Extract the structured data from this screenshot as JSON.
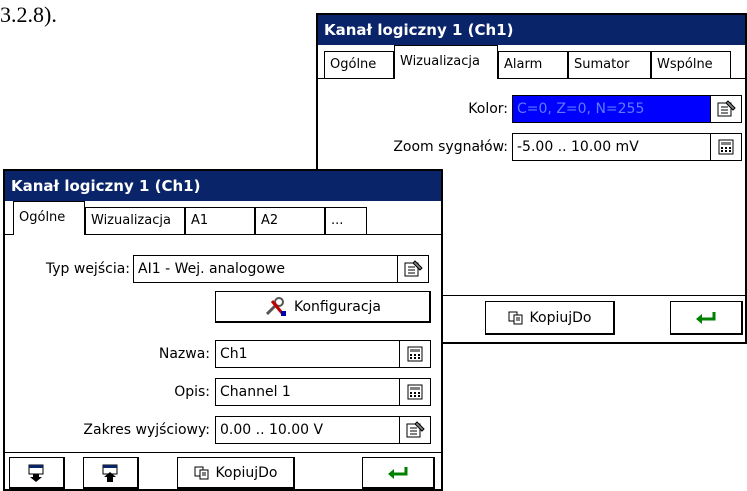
{
  "doc_text": "3.2.8).",
  "win_back": {
    "title": "Kanał logiczny 1 (Ch1)",
    "tabs": [
      "Ogólne",
      "Wizualizacja",
      "Alarm",
      "Sumator",
      "Wspólne"
    ],
    "active_tab": "Wizualizacja",
    "fields": {
      "color_label": "Kolor:",
      "color_value": "C=0, Z=0, N=255",
      "zoom_label": "Zoom sygnałów:",
      "zoom_value": "-5.00 .. 10.00 mV"
    },
    "buttons": {
      "copy_label": "KopiujDo"
    }
  },
  "win_front": {
    "title": "Kanał logiczny 1 (Ch1)",
    "tabs": [
      "Ogólne",
      "Wizualizacja",
      "A1",
      "A2",
      "..."
    ],
    "active_tab": "Ogólne",
    "fields": {
      "input_type_label": "Typ wejścia:",
      "input_type_value": "AI1 - Wej. analogowe",
      "config_label": "Konfiguracja",
      "name_label": "Nazwa:",
      "name_value": "Ch1",
      "desc_label": "Opis:",
      "desc_value": "Channel 1",
      "range_label": "Zakres wyjściowy:",
      "range_value": "0.00 .. 10.00 V"
    },
    "buttons": {
      "copy_label": "KopiujDo"
    }
  },
  "colors": {
    "titlebar": "#0a246a",
    "selection": "#0000ff",
    "enter_arrow": "#008000"
  },
  "icons": [
    "properties-icon",
    "calculator-icon",
    "tools-icon",
    "copy-icon",
    "move-down-icon",
    "move-up-icon",
    "enter-icon"
  ]
}
